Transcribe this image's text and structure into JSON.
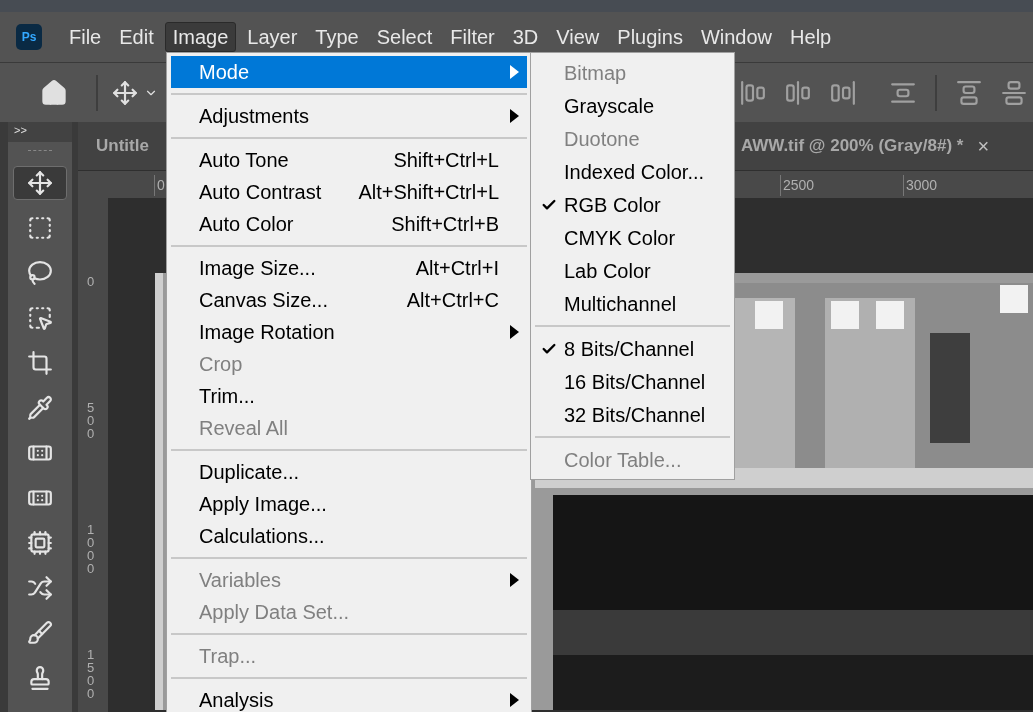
{
  "menubar": {
    "app_icon": "Ps",
    "items": [
      {
        "label": "File",
        "selected": false
      },
      {
        "label": "Edit",
        "selected": false
      },
      {
        "label": "Image",
        "selected": true
      },
      {
        "label": "Layer",
        "selected": false
      },
      {
        "label": "Type",
        "selected": false
      },
      {
        "label": "Select",
        "selected": false
      },
      {
        "label": "Filter",
        "selected": false
      },
      {
        "label": "3D",
        "selected": false
      },
      {
        "label": "View",
        "selected": false
      },
      {
        "label": "Plugins",
        "selected": false
      },
      {
        "label": "Window",
        "selected": false
      },
      {
        "label": "Help",
        "selected": false
      }
    ]
  },
  "toolbar": {
    "expand": ">>",
    "tools": [
      {
        "kind": "move",
        "selected": true
      },
      {
        "kind": "marquee",
        "selected": false
      },
      {
        "kind": "lasso",
        "selected": false
      },
      {
        "kind": "object-select",
        "selected": false
      },
      {
        "kind": "crop",
        "selected": false
      },
      {
        "kind": "eyedropper",
        "selected": false
      },
      {
        "kind": "spot-healing",
        "selected": false
      },
      {
        "kind": "healing",
        "selected": false
      },
      {
        "kind": "frame",
        "selected": false
      },
      {
        "kind": "content-move",
        "selected": false
      },
      {
        "kind": "brush",
        "selected": false
      },
      {
        "kind": "stamp",
        "selected": false
      }
    ]
  },
  "document_tabs": [
    {
      "title": "Untitle"
    },
    {
      "title": "AWW.tif @ 200% (Gray/8#) *",
      "close": "×"
    }
  ],
  "rulers": {
    "horizontal": [
      "0",
      "2500",
      "3000"
    ],
    "vertical": [
      "0",
      "500",
      "1000",
      "1500"
    ]
  },
  "image_menu": {
    "sections": [
      [
        {
          "label": "Mode",
          "submenu": true,
          "disabled": false,
          "selected": true
        }
      ],
      [
        {
          "label": "Adjustments",
          "submenu": true,
          "disabled": false,
          "selected": false
        }
      ],
      [
        {
          "label": "Auto Tone",
          "shortcut": "Shift+Ctrl+L",
          "disabled": false,
          "selected": false
        },
        {
          "label": "Auto Contrast",
          "shortcut": "Alt+Shift+Ctrl+L",
          "disabled": false,
          "selected": false
        },
        {
          "label": "Auto Color",
          "shortcut": "Shift+Ctrl+B",
          "disabled": false,
          "selected": false
        }
      ],
      [
        {
          "label": "Image Size...",
          "shortcut": "Alt+Ctrl+I",
          "disabled": false,
          "selected": false
        },
        {
          "label": "Canvas Size...",
          "shortcut": "Alt+Ctrl+C",
          "disabled": false,
          "selected": false
        },
        {
          "label": "Image Rotation",
          "submenu": true,
          "disabled": false,
          "selected": false
        },
        {
          "label": "Crop",
          "disabled": true,
          "selected": false
        },
        {
          "label": "Trim...",
          "disabled": false,
          "selected": false
        },
        {
          "label": "Reveal All",
          "disabled": true,
          "selected": false
        }
      ],
      [
        {
          "label": "Duplicate...",
          "disabled": false,
          "selected": false
        },
        {
          "label": "Apply Image...",
          "disabled": false,
          "selected": false
        },
        {
          "label": "Calculations...",
          "disabled": false,
          "selected": false
        }
      ],
      [
        {
          "label": "Variables",
          "submenu": true,
          "disabled": true,
          "selected": false
        },
        {
          "label": "Apply Data Set...",
          "disabled": true,
          "selected": false
        }
      ],
      [
        {
          "label": "Trap...",
          "disabled": true,
          "selected": false
        }
      ],
      [
        {
          "label": "Analysis",
          "submenu": true,
          "disabled": false,
          "selected": false
        }
      ]
    ]
  },
  "mode_submenu": {
    "sections": [
      [
        {
          "label": "Bitmap",
          "checked": false,
          "disabled": true
        },
        {
          "label": "Grayscale",
          "checked": false,
          "disabled": false
        },
        {
          "label": "Duotone",
          "checked": false,
          "disabled": true
        },
        {
          "label": "Indexed Color...",
          "checked": false,
          "disabled": false
        },
        {
          "label": "RGB Color",
          "checked": true,
          "disabled": false
        },
        {
          "label": "CMYK Color",
          "checked": false,
          "disabled": false
        },
        {
          "label": "Lab Color",
          "checked": false,
          "disabled": false
        },
        {
          "label": "Multichannel",
          "checked": false,
          "disabled": false
        }
      ],
      [
        {
          "label": "8 Bits/Channel",
          "checked": true,
          "disabled": false
        },
        {
          "label": "16 Bits/Channel",
          "checked": false,
          "disabled": false
        },
        {
          "label": "32 Bits/Channel",
          "checked": false,
          "disabled": false
        }
      ],
      [
        {
          "label": "Color Table...",
          "checked": false,
          "disabled": true
        }
      ]
    ]
  }
}
